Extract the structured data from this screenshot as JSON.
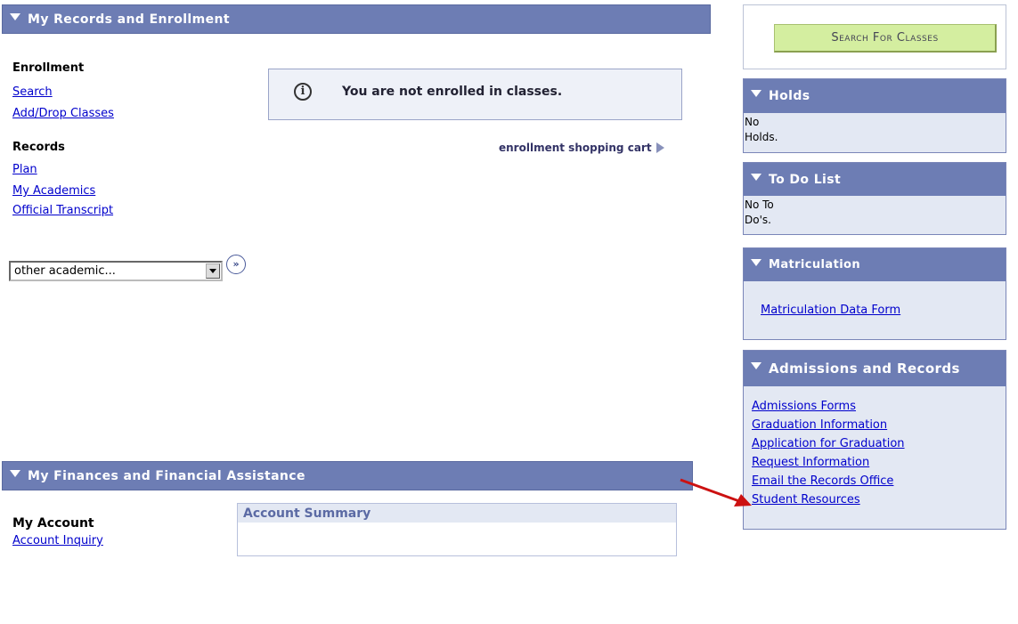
{
  "records_panel": {
    "title": "My Records and Enrollment",
    "enrollment_heading": "Enrollment",
    "enrollment_links": [
      "Search",
      "Add/Drop Classes"
    ],
    "records_heading": "Records",
    "records_links": [
      "Plan",
      "My Academics",
      "Official Transcript"
    ],
    "notice": "You are not enrolled in classes.",
    "cart_link": "enrollment shopping cart",
    "dropdown_value": "other academic..."
  },
  "finances_panel": {
    "title": "My Finances and Financial Assistance",
    "account_heading": "My Account",
    "account_link": "Account Inquiry",
    "summary_title": "Account Summary"
  },
  "search_button": "Search For Classes",
  "holds": {
    "title": "Holds",
    "text1": "No",
    "text2": "Holds."
  },
  "todo": {
    "title": "To Do List",
    "text1": "No To",
    "text2": "Do's."
  },
  "matriculation": {
    "title": "Matriculation",
    "link": "Matriculation Data Form"
  },
  "admissions": {
    "title": "Admissions and Records",
    "links": [
      "Admissions Forms",
      "Graduation Information",
      "Application for Graduation",
      "Request Information",
      "Email the Records Office",
      "Student Resources"
    ]
  },
  "colors": {
    "header": "#6d7db4",
    "panel": "#e3e8f3",
    "link": "#0000cc",
    "arrow": "#cc1111",
    "button": "#d4eea0"
  },
  "icons": [
    "expand-triangle-icon",
    "info-icon",
    "arrow-right-icon",
    "dropdown-arrow-icon",
    "go-double-arrow-icon",
    "red-pointer-arrow-icon"
  ]
}
